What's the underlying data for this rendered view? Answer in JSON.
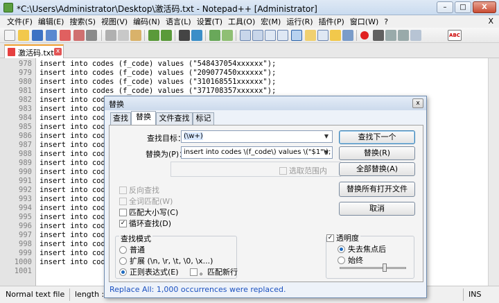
{
  "window": {
    "title": "*C:\\Users\\Administrator\\Desktop\\激活码.txt - Notepad++ [Administrator]",
    "controls": {
      "minimize": "–",
      "maximize": "□",
      "close": "X"
    }
  },
  "menu": {
    "items": [
      "文件(F)",
      "编辑(E)",
      "搜索(S)",
      "视图(V)",
      "编码(N)",
      "语言(L)",
      "设置(T)",
      "工具(O)",
      "宏(M)",
      "运行(R)",
      "插件(P)",
      "窗口(W)",
      "?"
    ],
    "close": "X"
  },
  "toolbar": {
    "icons": [
      "new-file-icon",
      "open-file-icon",
      "save-icon",
      "save-all-icon",
      "close-icon",
      "close-all-icon",
      "print-icon",
      "cut-icon",
      "copy-icon",
      "paste-icon",
      "undo-icon",
      "redo-icon",
      "find-icon",
      "replace-icon",
      "zoom-in-icon",
      "zoom-out-icon",
      "sync-vertical-icon",
      "sync-horizontal-icon",
      "word-wrap-icon",
      "show-all-chars-icon",
      "indent-guide-icon",
      "doc-map-icon",
      "function-list-icon",
      "folder-workspace-icon",
      "monitor-icon",
      "record-macro-icon",
      "stop-record-icon",
      "play-macro-icon",
      "run-macro-multiple-icon",
      "save-macro-icon",
      "spellcheck-icon"
    ],
    "spellcheck_label": "ABC"
  },
  "tab": {
    "label": "激活码.txt",
    "close": "x"
  },
  "editor": {
    "lines": [
      {
        "n": "978",
        "text": "insert into codes (f_code) values (\"548437054xxxxxx\");"
      },
      {
        "n": "979",
        "text": "insert into codes (f_code) values (\"209077450xxxxxx\");"
      },
      {
        "n": "980",
        "text": "insert into codes (f_code) values (\"310168551xxxxxx\");"
      },
      {
        "n": "981",
        "text": "insert into codes (f_code) values (\"371708357xxxxxx\");"
      },
      {
        "n": "982",
        "text": "insert into codes"
      },
      {
        "n": "983",
        "text": "insert into cod"
      },
      {
        "n": "984",
        "text": "insert into cod"
      },
      {
        "n": "985",
        "text": "insert into cod"
      },
      {
        "n": "986",
        "text": "insert into cod"
      },
      {
        "n": "987",
        "text": "insert into cod"
      },
      {
        "n": "988",
        "text": "insert into cod"
      },
      {
        "n": "989",
        "text": "insert into cod"
      },
      {
        "n": "990",
        "text": "insert into cod"
      },
      {
        "n": "991",
        "text": "insert into cod"
      },
      {
        "n": "992",
        "text": "insert into cod"
      },
      {
        "n": "993",
        "text": "insert into cod"
      },
      {
        "n": "994",
        "text": "insert into cod"
      },
      {
        "n": "995",
        "text": "insert into cod"
      },
      {
        "n": "996",
        "text": "insert into cod"
      },
      {
        "n": "997",
        "text": "insert into cod"
      },
      {
        "n": "998",
        "text": "insert into cod"
      },
      {
        "n": "999",
        "text": "insert into cod"
      },
      {
        "n": "1000",
        "text": "insert into cod"
      },
      {
        "n": "1001",
        "text": ""
      }
    ]
  },
  "status": {
    "type": "Normal text file",
    "length": "length : 5",
    "mode": "INS"
  },
  "dialog": {
    "title": "替换",
    "close": "x",
    "tabs": [
      "查找",
      "替换",
      "文件查找",
      "标记"
    ],
    "active_tab": "替换",
    "find_label": "查找目标：",
    "find_value": "(\\w+)",
    "replace_label": "替换为(P)：",
    "replace_value": "insert into codes \\(f_code\\) values \\(\"$1\"\\);",
    "in_selection": "选取范围内",
    "buttons": {
      "find_next": "查找下一个",
      "replace": "替换(R)",
      "replace_all": "全部替换(A)",
      "replace_all_open": "替换所有打开文件",
      "cancel": "取消"
    },
    "options": {
      "backward": {
        "label": "反向查找",
        "checked": false
      },
      "whole_word": {
        "label": "全词匹配(W)",
        "checked": false
      },
      "match_case": {
        "label": "匹配大小写(C)",
        "checked": false
      },
      "wrap_around": {
        "label": "循环查找(D)",
        "checked": true
      }
    },
    "search_mode": {
      "label": "查找模式",
      "normal": "普通",
      "extended": "扩展 (\\n, \\r, \\t, \\0, \\x...)",
      "regex": "正则表达式(E)",
      "selected": "regex",
      "dot_newline": "。匹配新行"
    },
    "transparency": {
      "label": "透明度",
      "checked": true,
      "on_lose_focus": "失去焦点后",
      "always": "始终",
      "selected": "on_lose_focus",
      "level": 0.68
    },
    "status_message": "Replace All: 1,000 occurrences were replaced."
  }
}
